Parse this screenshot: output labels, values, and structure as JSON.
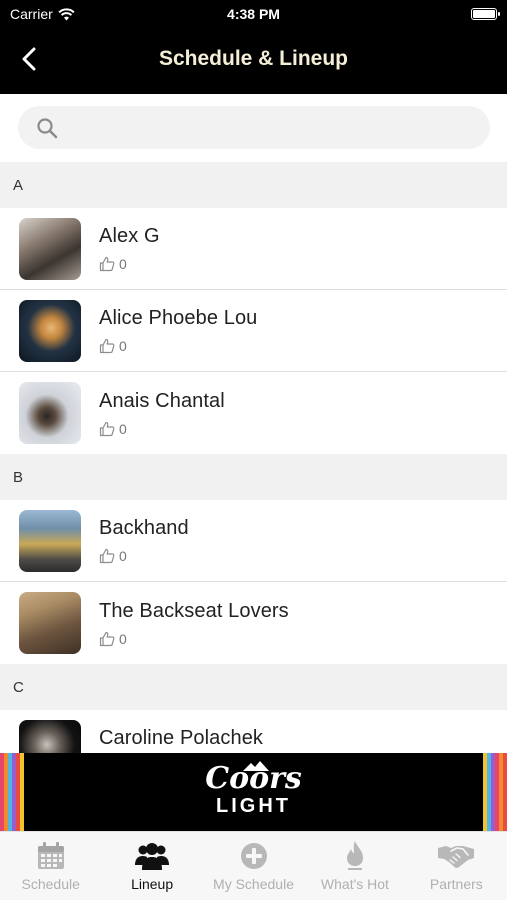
{
  "status_bar": {
    "carrier": "Carrier",
    "time": "4:38 PM"
  },
  "header": {
    "title": "Schedule & Lineup"
  },
  "search": {
    "placeholder": ""
  },
  "sections": [
    {
      "letter": "A",
      "artists": [
        {
          "name": "Alex G",
          "likes": "0"
        },
        {
          "name": "Alice Phoebe Lou",
          "likes": "0"
        },
        {
          "name": "Anais Chantal",
          "likes": "0"
        }
      ]
    },
    {
      "letter": "B",
      "artists": [
        {
          "name": "Backhand",
          "likes": "0"
        },
        {
          "name": "The Backseat Lovers",
          "likes": "0"
        }
      ]
    },
    {
      "letter": "C",
      "artists": [
        {
          "name": "Caroline Polachek",
          "likes": "0"
        }
      ]
    }
  ],
  "ad": {
    "line1": "Coors",
    "line2": "LIGHT"
  },
  "tabs": [
    {
      "label": "Schedule",
      "icon": "calendar-icon"
    },
    {
      "label": "Lineup",
      "icon": "people-icon",
      "active": true
    },
    {
      "label": "My Schedule",
      "icon": "plus-circle-icon"
    },
    {
      "label": "What's Hot",
      "icon": "flame-icon"
    },
    {
      "label": "Partners",
      "icon": "handshake-icon"
    }
  ],
  "colors": {
    "header_bg": "#000000",
    "title": "#f4efd6",
    "tab_active": "#111111",
    "tab_inactive": "#b0b0b0",
    "section_bg": "#f1f1f1"
  }
}
